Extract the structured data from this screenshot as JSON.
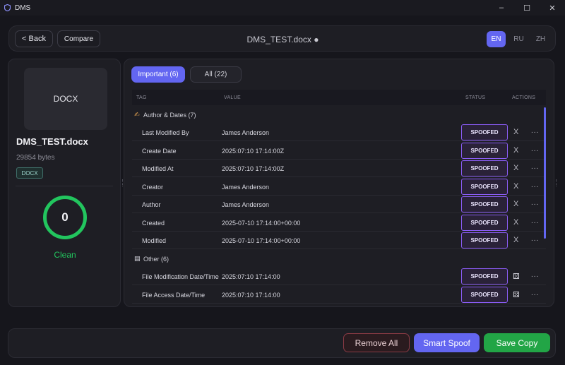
{
  "window": {
    "title": "DMS",
    "controls": {
      "minimize": "–",
      "maximize": "☐",
      "close": "✕"
    }
  },
  "header": {
    "back_label": "< Back",
    "compare_label": "Compare",
    "document_title": "DMS_TEST.docx ●",
    "languages": [
      {
        "code": "EN",
        "active": true
      },
      {
        "code": "RU",
        "active": false
      },
      {
        "code": "ZH",
        "active": false
      }
    ]
  },
  "file_panel": {
    "thumbnail_label": "DOCX",
    "file_name": "DMS_TEST.docx",
    "file_size": "29854 bytes",
    "file_type_badge": "DOCX",
    "risk_score": "0",
    "risk_label": "Clean",
    "risk_color": "#22c55e"
  },
  "tabs": [
    {
      "label": "Important (6)",
      "active": true
    },
    {
      "label": "All (22)",
      "active": false
    }
  ],
  "table": {
    "columns": {
      "tag": "TAG",
      "value": "VALUE",
      "status": "STATUS",
      "actions": "ACTIONS"
    },
    "sections": [
      {
        "icon": "writing-hand-icon",
        "label": "Author & Dates (7)",
        "rows": [
          {
            "tag": "Last Modified By",
            "value": "James Anderson",
            "status": "SPOOFED",
            "action": "X",
            "more": "..."
          },
          {
            "tag": "Create Date",
            "value": "2025:07:10 17:14:00Z",
            "status": "SPOOFED",
            "action": "X",
            "more": "..."
          },
          {
            "tag": "Modified At",
            "value": "2025:07:10 17:14:00Z",
            "status": "SPOOFED",
            "action": "X",
            "more": "..."
          },
          {
            "tag": "Creator",
            "value": "James Anderson",
            "status": "SPOOFED",
            "action": "X",
            "more": "..."
          },
          {
            "tag": "Author",
            "value": "James Anderson",
            "status": "SPOOFED",
            "action": "X",
            "more": "..."
          },
          {
            "tag": "Created",
            "value": "2025-07-10 17:14:00+00:00",
            "status": "SPOOFED",
            "action": "X",
            "more": "..."
          },
          {
            "tag": "Modified",
            "value": "2025-07-10 17:14:00+00:00",
            "status": "SPOOFED",
            "action": "X",
            "more": "..."
          }
        ]
      },
      {
        "icon": "memo-icon",
        "label": "Other (6)",
        "rows": [
          {
            "tag": "File Modification Date/Time",
            "value": "2025:07:10 17:14:00",
            "status": "SPOOFED",
            "action": "dice",
            "more": "..."
          },
          {
            "tag": "File Access Date/Time",
            "value": "2025:07:10 17:14:00",
            "status": "SPOOFED",
            "action": "dice",
            "more": "..."
          }
        ]
      }
    ]
  },
  "footer": {
    "remove_all_label": "Remove All",
    "smart_spoof_label": "Smart Spoof",
    "save_copy_label": "Save Copy"
  },
  "colors": {
    "accent": "#6366f1",
    "spoofed_border": "#8b5cf6",
    "success": "#22a546",
    "danger_border": "#8a3a44"
  }
}
